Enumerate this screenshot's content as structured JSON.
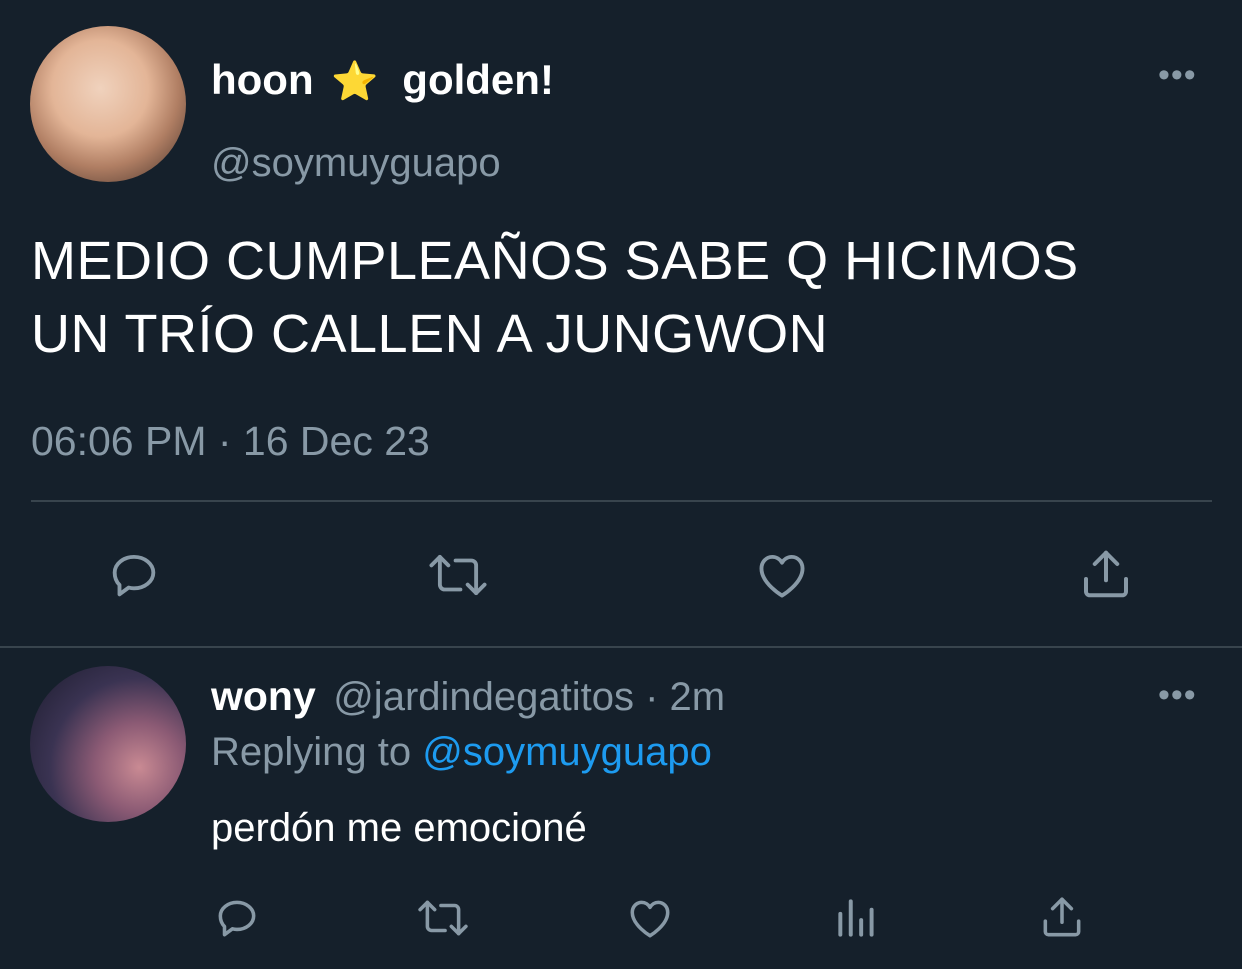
{
  "tweet": {
    "name": "hoon",
    "name_badge": "⭐",
    "name_suffix": "golden!",
    "handle": "@soymuyguapo",
    "text_line1": "MEDIO CUMPLEAÑOS SABE Q HICIMOS",
    "text_line2": "UN TRÍO CALLEN A JUNGWON",
    "timestamp": "06:06 PM · 16 Dec 23",
    "more_label": "•••"
  },
  "reply": {
    "name": "wony",
    "handle_time": "@jardindegatitos · 2m",
    "replying_prefix": "Replying to",
    "replying_to": "@soymuyguapo",
    "text": "perdón me emocioné",
    "more_label": "•••"
  },
  "icons": {
    "tweet_actions": [
      "reply-icon",
      "retweet-icon",
      "like-icon",
      "share-icon"
    ],
    "reply_actions": [
      "reply-icon",
      "retweet-icon",
      "like-icon",
      "analytics-icon",
      "share-icon"
    ]
  },
  "colors": {
    "background": "#15202b",
    "secondary": "#8899a6",
    "link": "#1d9bf0",
    "divider": "#38444d"
  }
}
